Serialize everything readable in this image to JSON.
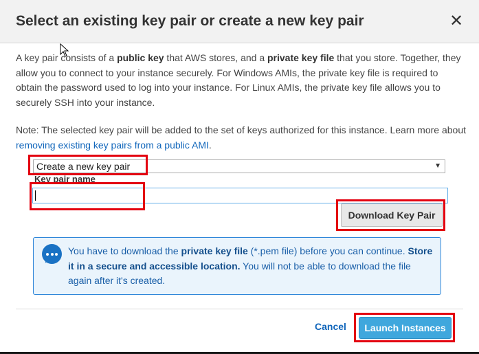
{
  "dialog": {
    "title": "Select an existing key pair or create a new key pair",
    "close_glyph": "✕",
    "intro": [
      {
        "text": "A key pair consists of a ",
        "bold": false
      },
      {
        "text": "public key",
        "bold": true
      },
      {
        "text": " that AWS stores, and a ",
        "bold": false
      },
      {
        "text": "private key file",
        "bold": true
      },
      {
        "text": " that you store. Together, they allow you to connect to your instance securely. For Windows AMIs, the private key file is required to obtain the password used to log into your instance. For Linux AMIs, the private key file allows you to securely SSH into your instance.",
        "bold": false
      }
    ],
    "note_prefix": "Note: The selected key pair will be added to the set of keys authorized for this instance. Learn more about",
    "note_link": "removing existing key pairs from a public AMI",
    "note_suffix": "."
  },
  "form": {
    "selected_option": "Create a new key pair",
    "key_pair_name_label": "Key pair name",
    "key_pair_name_value": "",
    "download_button": "Download Key Pair"
  },
  "info": {
    "icon": "chat-bubble-icon",
    "parts": [
      {
        "text": "You have to download the ",
        "bold": false
      },
      {
        "text": "private key file",
        "bold": true
      },
      {
        "text": " (*.pem file) before you can continue. ",
        "bold": false
      },
      {
        "text": "Store it in a secure and accessible location.",
        "bold": true
      },
      {
        "text": " You will not be able to download the file again after it's created.",
        "bold": false
      }
    ]
  },
  "footer": {
    "cancel_label": "Cancel",
    "launch_label": "Launch Instances"
  },
  "colors": {
    "highlight": "#e3000f",
    "link": "#1166bb",
    "primary_button": "#3fa7dd",
    "info_border": "#2e86d9",
    "info_background": "#eaf4fc"
  }
}
